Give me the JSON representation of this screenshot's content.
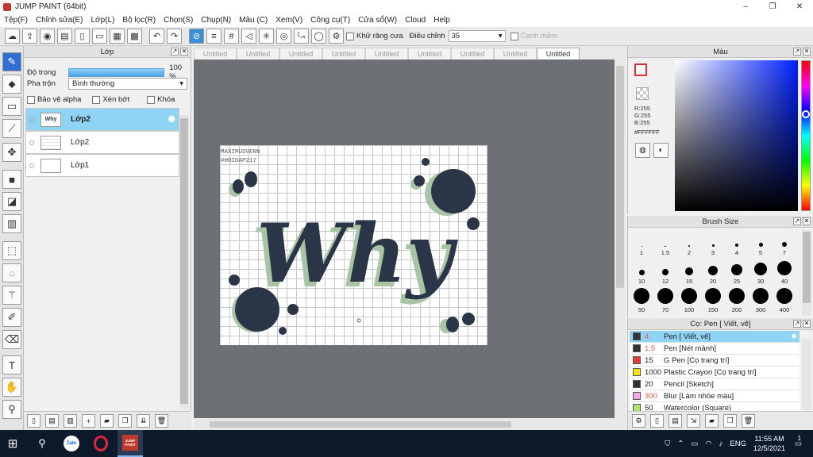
{
  "window": {
    "title": "JUMP PAINT (64bit)",
    "controls": [
      "–",
      "❐",
      "✕"
    ]
  },
  "menu": [
    "Tệp(F)",
    "Chỉnh sửa(E)",
    "Lớp(L)",
    "Bộ lọc(R)",
    "Chọn(S)",
    "Chụp(N)",
    "Màu (C)",
    "Xem(V)",
    "Công cụ(T)",
    "Cửa sổ(W)",
    "Cloud",
    "Help"
  ],
  "toolbar": {
    "antialias_label": "Khử răng cưa",
    "adjust_label": "Điều chỉnh",
    "adjust_value": "35",
    "edge_label": "Cạnh mềm"
  },
  "layer_panel": {
    "title": "Lớp",
    "opacity_label": "Độ trong",
    "opacity_value": "100 %",
    "opacity_fraction": 1.0,
    "blend_label": "Pha trộn",
    "blend_value": "Bình thường",
    "protect_alpha": "Bảo vệ alpha",
    "clipping": "Xén bớt",
    "lock": "Khóa",
    "layers": [
      {
        "name": "Lớp2",
        "thumb": "Why",
        "selected": true
      },
      {
        "name": "Lớp2",
        "thumb": "",
        "selected": false
      },
      {
        "name": "Lớp1",
        "thumb": "",
        "selected": false
      }
    ]
  },
  "tabs": [
    "Untitled",
    "Untitled",
    "Untitled",
    "Untitled",
    "Untitled",
    "Untitled",
    "Untitled",
    "Untitled",
    "Untitled"
  ],
  "active_tab": 8,
  "canvas": {
    "word": "Why",
    "signature_line1": "MAXIMUSVENN",
    "signature_line2": "#HOIDAP217",
    "ink_color": "#2a3648",
    "shadow_color": "#a7c4a4"
  },
  "color_panel": {
    "title": "Màu",
    "r": "R:255",
    "g": "G:255",
    "b": "B:255",
    "hex": "#FFFFFF"
  },
  "brush_panel": {
    "title": "Brush Size",
    "sizes": [
      "1",
      "1.5",
      "2",
      "3",
      "4",
      "5",
      "7",
      "10",
      "12",
      "15",
      "20",
      "25",
      "30",
      "40",
      "50",
      "70",
      "100",
      "150",
      "200",
      "300",
      "400"
    ]
  },
  "pen_panel": {
    "title": "Cọ: Pen [ Viết, vẽ]",
    "items": [
      {
        "size": "4",
        "name": "Pen [ Viết, vẽ]",
        "color": "#333333",
        "selected": true
      },
      {
        "size": "1.5",
        "name": "Pen [Nét mảnh]",
        "color": "#333333",
        "selected": false
      },
      {
        "size": "15",
        "name": "G Pen [Cọ trang trí]",
        "color": "#e53935",
        "selected": false
      },
      {
        "size": "1000",
        "name": "Plastic Crayon [Cọ trang trí]",
        "color": "#f4e21c",
        "selected": false
      },
      {
        "size": "20",
        "name": "Pencil [Sketch]",
        "color": "#333333",
        "selected": false
      },
      {
        "size": "300",
        "name": "Blur [Làm nhòe màu]",
        "color": "#f4a6e8",
        "selected": false
      },
      {
        "size": "50",
        "name": "Watercolor (Square)",
        "color": "#b6e06b",
        "selected": false
      }
    ]
  },
  "taskbar": {
    "apps": [
      "Zalo",
      "Opera",
      "JUMP PAINT"
    ],
    "lang": "ENG",
    "time": "11:55 AM",
    "date": "12/5/2021",
    "notifications": "1"
  },
  "colors": {
    "accent": "#2f6fd1",
    "selection": "#8fd3f5",
    "canvas_bg": "#6d7074"
  }
}
